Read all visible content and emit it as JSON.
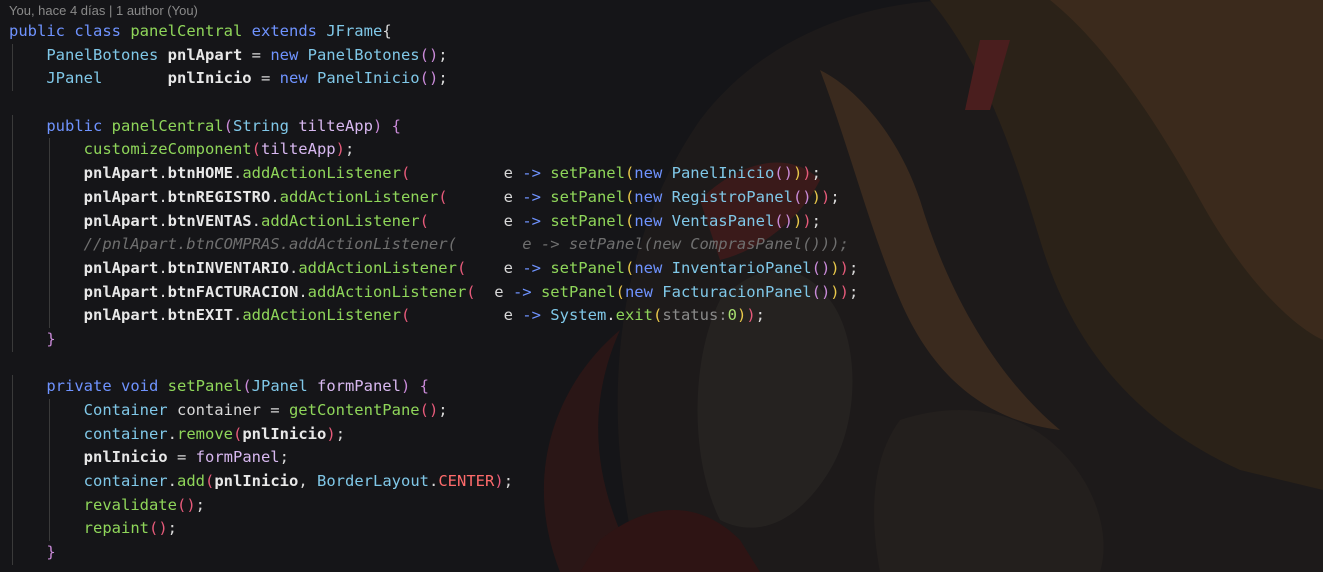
{
  "codelens": "You, hace 4 días | 1 author (You)",
  "colors": {
    "background": "#151518",
    "keyword": "#6f93ff",
    "class": "#80c8e8",
    "function": "#8fd65a",
    "comment": "#6f6f6f",
    "bracket_1": "#e8c84a",
    "bracket_2": "#c98ad8",
    "bracket_3": "#e65a7a"
  },
  "code_lines": [
    [
      [
        "kw",
        "public class "
      ],
      [
        "fn",
        "panelCentral "
      ],
      [
        "kw",
        "extends "
      ],
      [
        "cls",
        "JFrame"
      ],
      [
        "txt",
        "{"
      ]
    ],
    [
      [
        "txt",
        "    "
      ],
      [
        "cls",
        "PanelBotones "
      ],
      [
        "field",
        "pnlApart"
      ],
      [
        "txt",
        " = "
      ],
      [
        "kw",
        "new "
      ],
      [
        "cls",
        "PanelBotones"
      ],
      [
        "p2",
        "()"
      ],
      [
        "txt",
        ";"
      ]
    ],
    [
      [
        "txt",
        "    "
      ],
      [
        "cls",
        "JPanel       "
      ],
      [
        "field",
        "pnlInicio"
      ],
      [
        "txt",
        " = "
      ],
      [
        "kw",
        "new "
      ],
      [
        "cls",
        "PanelInicio"
      ],
      [
        "p2",
        "()"
      ],
      [
        "txt",
        ";"
      ]
    ],
    [],
    [
      [
        "txt",
        "    "
      ],
      [
        "kw",
        "public "
      ],
      [
        "fn",
        "panelCentral"
      ],
      [
        "p2",
        "("
      ],
      [
        "cls",
        "String "
      ],
      [
        "param",
        "tilteApp"
      ],
      [
        "p2",
        ")"
      ],
      [
        "txt",
        " "
      ],
      [
        "p2",
        "{"
      ]
    ],
    [
      [
        "txt",
        "        "
      ],
      [
        "fn",
        "customizeComponent"
      ],
      [
        "p3",
        "("
      ],
      [
        "param",
        "tilteApp"
      ],
      [
        "p3",
        ")"
      ],
      [
        "txt",
        ";"
      ]
    ],
    [
      [
        "txt",
        "        "
      ],
      [
        "field",
        "pnlApart"
      ],
      [
        "txt",
        "."
      ],
      [
        "field",
        "btnHOME"
      ],
      [
        "txt",
        "."
      ],
      [
        "fn",
        "addActionListener"
      ],
      [
        "p3",
        "("
      ],
      [
        "txt",
        "          e "
      ],
      [
        "kw",
        "-> "
      ],
      [
        "fn",
        "setPanel"
      ],
      [
        "p1",
        "("
      ],
      [
        "kw",
        "new "
      ],
      [
        "cls",
        "PanelInicio"
      ],
      [
        "p2",
        "()"
      ],
      [
        "p1",
        ")"
      ],
      [
        "p3",
        ")"
      ],
      [
        "txt",
        ";"
      ]
    ],
    [
      [
        "txt",
        "        "
      ],
      [
        "field",
        "pnlApart"
      ],
      [
        "txt",
        "."
      ],
      [
        "field",
        "btnREGISTRO"
      ],
      [
        "txt",
        "."
      ],
      [
        "fn",
        "addActionListener"
      ],
      [
        "p3",
        "("
      ],
      [
        "txt",
        "      e "
      ],
      [
        "kw",
        "-> "
      ],
      [
        "fn",
        "setPanel"
      ],
      [
        "p1",
        "("
      ],
      [
        "kw",
        "new "
      ],
      [
        "cls",
        "RegistroPanel"
      ],
      [
        "p2",
        "()"
      ],
      [
        "p1",
        ")"
      ],
      [
        "p3",
        ")"
      ],
      [
        "txt",
        ";"
      ]
    ],
    [
      [
        "txt",
        "        "
      ],
      [
        "field",
        "pnlApart"
      ],
      [
        "txt",
        "."
      ],
      [
        "field",
        "btnVENTAS"
      ],
      [
        "txt",
        "."
      ],
      [
        "fn",
        "addActionListener"
      ],
      [
        "p3",
        "("
      ],
      [
        "txt",
        "        e "
      ],
      [
        "kw",
        "-> "
      ],
      [
        "fn",
        "setPanel"
      ],
      [
        "p1",
        "("
      ],
      [
        "kw",
        "new "
      ],
      [
        "cls",
        "VentasPanel"
      ],
      [
        "p2",
        "()"
      ],
      [
        "p1",
        ")"
      ],
      [
        "p3",
        ")"
      ],
      [
        "txt",
        ";"
      ]
    ],
    [
      [
        "txt",
        "        "
      ],
      [
        "cm",
        "//pnlApart.btnCOMPRAS.addActionListener(       e -> setPanel(new ComprasPanel()));"
      ]
    ],
    [
      [
        "txt",
        "        "
      ],
      [
        "field",
        "pnlApart"
      ],
      [
        "txt",
        "."
      ],
      [
        "field",
        "btnINVENTARIO"
      ],
      [
        "txt",
        "."
      ],
      [
        "fn",
        "addActionListener"
      ],
      [
        "p3",
        "("
      ],
      [
        "txt",
        "    e "
      ],
      [
        "kw",
        "-> "
      ],
      [
        "fn",
        "setPanel"
      ],
      [
        "p1",
        "("
      ],
      [
        "kw",
        "new "
      ],
      [
        "cls",
        "InventarioPanel"
      ],
      [
        "p2",
        "()"
      ],
      [
        "p1",
        ")"
      ],
      [
        "p3",
        ")"
      ],
      [
        "txt",
        ";"
      ]
    ],
    [
      [
        "txt",
        "        "
      ],
      [
        "field",
        "pnlApart"
      ],
      [
        "txt",
        "."
      ],
      [
        "field",
        "btnFACTURACION"
      ],
      [
        "txt",
        "."
      ],
      [
        "fn",
        "addActionListener"
      ],
      [
        "p3",
        "("
      ],
      [
        "txt",
        "  e "
      ],
      [
        "kw",
        "-> "
      ],
      [
        "fn",
        "setPanel"
      ],
      [
        "p1",
        "("
      ],
      [
        "kw",
        "new "
      ],
      [
        "cls",
        "FacturacionPanel"
      ],
      [
        "p2",
        "()"
      ],
      [
        "p1",
        ")"
      ],
      [
        "p3",
        ")"
      ],
      [
        "txt",
        ";"
      ]
    ],
    [
      [
        "txt",
        "        "
      ],
      [
        "field",
        "pnlApart"
      ],
      [
        "txt",
        "."
      ],
      [
        "field",
        "btnEXIT"
      ],
      [
        "txt",
        "."
      ],
      [
        "fn",
        "addActionListener"
      ],
      [
        "p3",
        "("
      ],
      [
        "txt",
        "          e "
      ],
      [
        "kw",
        "-> "
      ],
      [
        "cls",
        "System"
      ],
      [
        "txt",
        "."
      ],
      [
        "fn",
        "exit"
      ],
      [
        "p1",
        "("
      ],
      [
        "hint",
        "status:"
      ],
      [
        "num",
        "0"
      ],
      [
        "p1",
        ")"
      ],
      [
        "p3",
        ")"
      ],
      [
        "txt",
        ";"
      ]
    ],
    [
      [
        "txt",
        "    "
      ],
      [
        "p2",
        "}"
      ]
    ],
    [],
    [
      [
        "txt",
        "    "
      ],
      [
        "kw",
        "private void "
      ],
      [
        "fn",
        "setPanel"
      ],
      [
        "p2",
        "("
      ],
      [
        "cls",
        "JPanel "
      ],
      [
        "param",
        "formPanel"
      ],
      [
        "p2",
        ")"
      ],
      [
        "txt",
        " "
      ],
      [
        "p2",
        "{"
      ]
    ],
    [
      [
        "txt",
        "        "
      ],
      [
        "cls",
        "Container "
      ],
      [
        "txt",
        "container = "
      ],
      [
        "fn",
        "getContentPane"
      ],
      [
        "p3",
        "()"
      ],
      [
        "txt",
        ";"
      ]
    ],
    [
      [
        "txt",
        "        "
      ],
      [
        "cls",
        "container"
      ],
      [
        "txt",
        "."
      ],
      [
        "fn",
        "remove"
      ],
      [
        "p3",
        "("
      ],
      [
        "field",
        "pnlInicio"
      ],
      [
        "p3",
        ")"
      ],
      [
        "txt",
        ";"
      ]
    ],
    [
      [
        "txt",
        "        "
      ],
      [
        "field",
        "pnlInicio"
      ],
      [
        "txt",
        " = "
      ],
      [
        "param",
        "formPanel"
      ],
      [
        "txt",
        ";"
      ]
    ],
    [
      [
        "txt",
        "        "
      ],
      [
        "cls",
        "container"
      ],
      [
        "txt",
        "."
      ],
      [
        "fn",
        "add"
      ],
      [
        "p3",
        "("
      ],
      [
        "field",
        "pnlInicio"
      ],
      [
        "txt",
        ", "
      ],
      [
        "cls",
        "BorderLayout"
      ],
      [
        "txt",
        "."
      ],
      [
        "const",
        "CENTER"
      ],
      [
        "p3",
        ")"
      ],
      [
        "txt",
        ";"
      ]
    ],
    [
      [
        "txt",
        "        "
      ],
      [
        "fn",
        "revalidate"
      ],
      [
        "p3",
        "()"
      ],
      [
        "txt",
        ";"
      ]
    ],
    [
      [
        "txt",
        "        "
      ],
      [
        "fn",
        "repaint"
      ],
      [
        "p3",
        "()"
      ],
      [
        "txt",
        ";"
      ]
    ],
    [
      [
        "txt",
        "    "
      ],
      [
        "p2",
        "}"
      ]
    ]
  ]
}
